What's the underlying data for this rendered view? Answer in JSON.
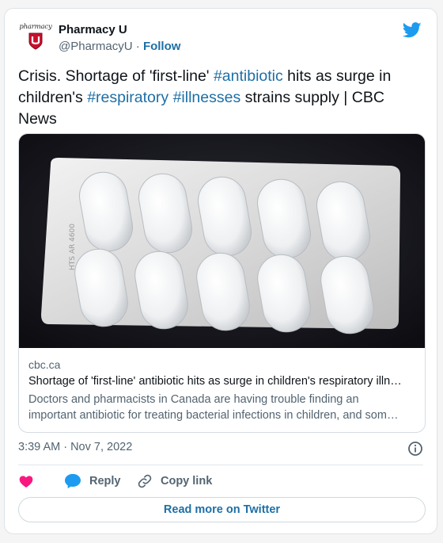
{
  "author": {
    "logo_text": "pharmacy",
    "name": "Pharmacy U",
    "handle": "@PharmacyU",
    "separator": "·",
    "follow_label": "Follow"
  },
  "icons": {
    "logo": "pharmacy-u-shield-logo",
    "brand": "twitter-bird-icon",
    "info": "info-circle-icon",
    "like": "heart-icon",
    "reply": "speech-bubble-icon",
    "copy": "chain-link-icon"
  },
  "colors": {
    "accent": "#1d6fa5",
    "twitter_blue": "#1d9bf0",
    "heart": "#f91880",
    "muted": "#536471"
  },
  "tweet": {
    "text_parts": {
      "t1": "Crisis. Shortage of 'first-line' ",
      "h1": "#antibiotic",
      "t2": " hits as surge in children's ",
      "h2": "#respiratory",
      "t3": " ",
      "h3": "#illnesses",
      "t4": " strains supply | CBC News"
    }
  },
  "link_card": {
    "domain": "cbc.ca",
    "title": "Shortage of 'first-line' antibiotic hits as surge in children's respiratory illn…",
    "description_line1": "Doctors and pharmacists in Canada are having trouble finding an",
    "description_line2": "important antibiotic for treating bacterial infections in children, and som…"
  },
  "meta": {
    "timestamp": "3:39 AM · Nov 7, 2022"
  },
  "actions": {
    "reply_label": "Reply",
    "copy_link_label": "Copy link"
  },
  "footer": {
    "read_more_label": "Read more on Twitter"
  }
}
